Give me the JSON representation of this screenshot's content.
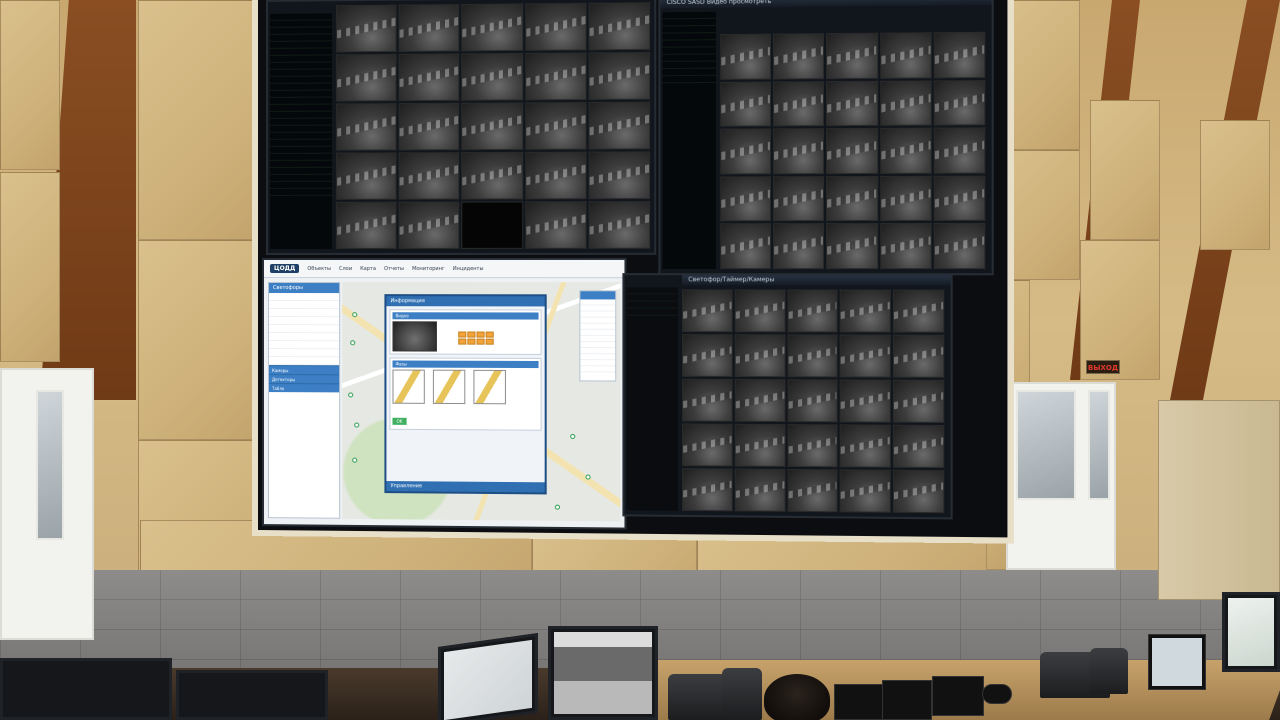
{
  "scene": {
    "wall_color": "#d2b682",
    "accent_wood": "#7a4420",
    "screen_accent": "#3c7fc4"
  },
  "exit_sign": {
    "text": "ВЫХОД"
  },
  "video_wall": {
    "top_left": {
      "title": "",
      "camera_grid": {
        "cols": 5,
        "rows": 5
      }
    },
    "top_right": {
      "title": "CISCO  SASD Видео просмотреть",
      "camera_grid": {
        "cols": 5,
        "rows": 5
      }
    },
    "bottom_right": {
      "title": "Светофор/Таймер/Камеры",
      "camera_grid": {
        "cols": 5,
        "rows": 5
      }
    },
    "map_app": {
      "logo": "ЦОДД",
      "menu": [
        "Объекты",
        "Слои",
        "Карта",
        "Отчеты",
        "Мониторинг",
        "Инциденты"
      ],
      "sidebar_head": "Светофоры",
      "sidebar_tabs": [
        "Камеры",
        "Детекторы",
        "Табло"
      ],
      "dialog": {
        "title": "Информация",
        "section_video": "Видео",
        "section_phases": "Фазы",
        "ok_label": "OK",
        "footer": "Управление"
      }
    }
  }
}
